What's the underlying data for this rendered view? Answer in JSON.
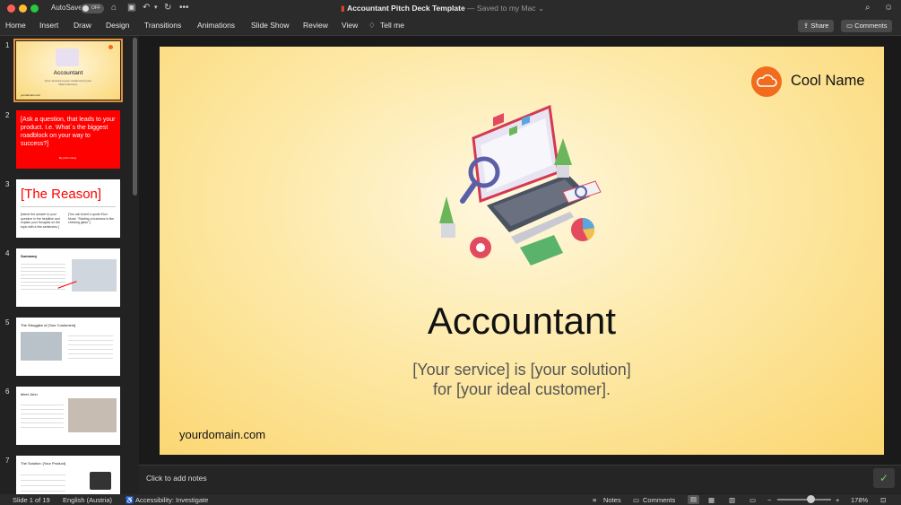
{
  "titlebar": {
    "autosave_label": "AutoSave",
    "autosave_state": "OFF",
    "doc_name": "Accountant Pitch Deck Template",
    "doc_status": "— Saved to my Mac"
  },
  "ribbon": {
    "tabs": [
      "Home",
      "Insert",
      "Draw",
      "Design",
      "Transitions",
      "Animations",
      "Slide Show",
      "Review",
      "View"
    ],
    "tell_me": "Tell me",
    "share_label": "Share",
    "comments_label": "Comments"
  },
  "thumbnails": {
    "numbers": [
      "1",
      "2",
      "3",
      "4",
      "5",
      "6",
      "7"
    ],
    "t1_title": "Accountant",
    "t1_sub": "[Your service] is [your solution] for [your ideal customer].",
    "t1_url": "yourdomain.com",
    "t2_text": "[Ask a question, that leads to your product. I.e. What´s the biggest roadblock on your way to success?]",
    "t2_by": "By [John Doe]",
    "t3_title": "[The Reason]",
    "t3_left": "[Name the answer to your question in the headline and explain your thoughts on the topic with a few sentences.]",
    "t3_right": "[You can insert a quote Elon Musk: \"Starting a business is like chewing glass\".]",
    "t4_title": "Summary",
    "t5_title": "The Struggles of [Your Customers]",
    "t6_title": "Meet John",
    "t7_title": "The Solution: [Your Product]"
  },
  "slide": {
    "brand_name": "Cool Name",
    "title": "Accountant",
    "subtitle_line1": "[Your service] is [your solution]",
    "subtitle_line2": "for [your ideal customer].",
    "footer_url": "yourdomain.com"
  },
  "notes": {
    "placeholder": "Click to add notes"
  },
  "statusbar": {
    "slide_info": "Slide 1 of 19",
    "language": "English (Austria)",
    "accessibility": "Accessibility: Investigate",
    "notes_label": "Notes",
    "comments_label": "Comments",
    "zoom": "178%"
  },
  "colors": {
    "accent": "#f26c1e",
    "red_slide": "#ff0000",
    "slide_bg": "#fde39a"
  }
}
